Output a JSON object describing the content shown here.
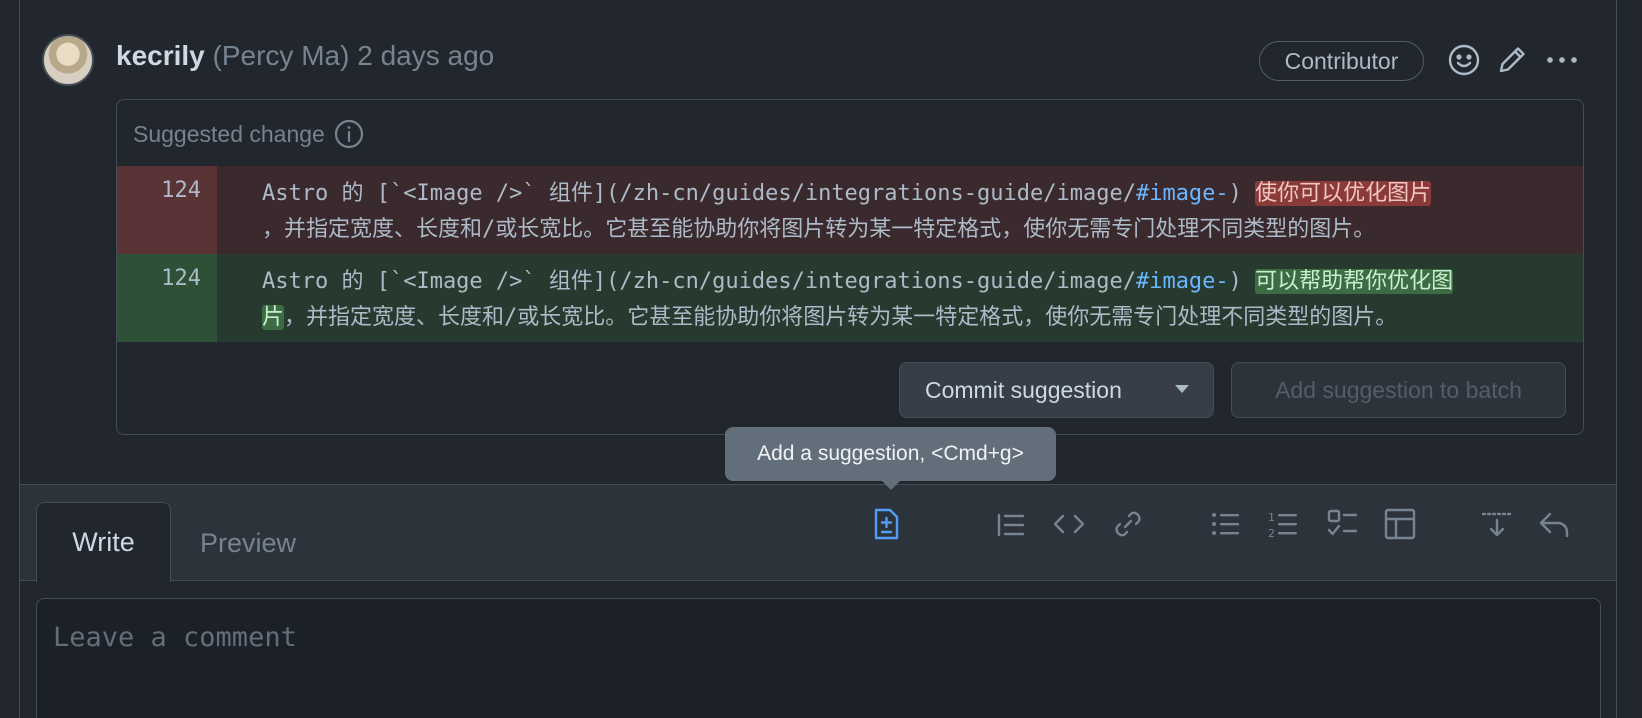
{
  "comment": {
    "author": "kecrily",
    "full_name": "(Percy Ma)",
    "time": "2 days ago",
    "badge": "Contributor"
  },
  "suggestion": {
    "title": "Suggested change",
    "deleted": {
      "line_number": "124",
      "pre": "Astro 的 [`<Image />` 组件](/zh-cn/guides/integrations-guide/image/",
      "anchor": "#image-",
      "mid": ") ",
      "highlight": "使你可以优化图片",
      "line2": "，并指定宽度、长度和/或长宽比。它甚至能协助你将图片转为某一特定格式，使你无需专门处理不同类型的图片。"
    },
    "added": {
      "line_number": "124",
      "pre": "Astro 的 [`<Image />` 组件](/zh-cn/guides/integrations-guide/image/",
      "anchor": "#image-",
      "mid": ") ",
      "highlight": "可以帮助帮你优化图",
      "highlight2": "片",
      "line2": "，并指定宽度、长度和/或长宽比。它甚至能协助你将图片转为某一特定格式，使你无需专门处理不同类型的图片。"
    },
    "commit_button": "Commit suggestion",
    "batch_button": "Add suggestion to batch"
  },
  "tooltip": "Add a suggestion, <Cmd+g>",
  "editor": {
    "tabs": [
      "Write",
      "Preview"
    ],
    "placeholder": "Leave a comment",
    "toolbar_icons": [
      "suggestion-icon",
      "quote-icon",
      "code-icon",
      "link-icon",
      "unordered-list-icon",
      "ordered-list-icon",
      "task-list-icon",
      "table-icon",
      "mention-down-icon",
      "reply-icon"
    ]
  },
  "colors": {
    "background": "#22272e",
    "deleted_bg": "#3a2a2e",
    "added_bg": "#263a30",
    "accent": "#539bf5"
  }
}
